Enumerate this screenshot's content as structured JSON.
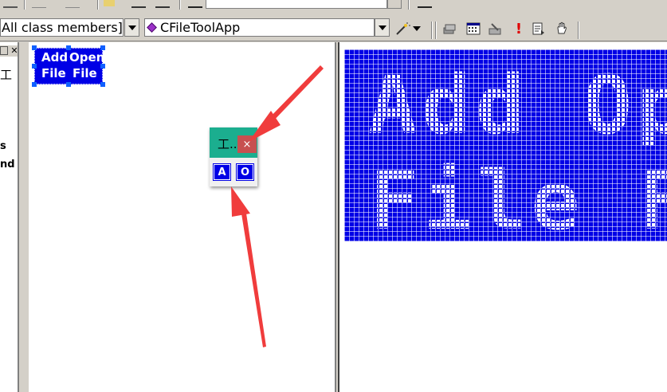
{
  "toolbar": {
    "class_filter": "All class members]",
    "class_name": "CFileToolApp",
    "search_value": ""
  },
  "left_pane": {
    "glyph": "工",
    "text_line_1": "s",
    "text_line_2": "nd"
  },
  "resource_bitmap": {
    "label_add": "Add",
    "label_open": "Open",
    "label_file_1": "File",
    "label_file_2": "File"
  },
  "floating_toolbar": {
    "title": "工..",
    "close_glyph": "×",
    "button_a": "A",
    "button_o": "O"
  },
  "zoom_view": {
    "line_1": "Add Ope",
    "line_2": "File Fil"
  },
  "colors": {
    "bitmap_blue": "#0000e6",
    "title_teal": "#1bae8f",
    "close_red": "#c75050",
    "arrow_red": "#f03c3c"
  }
}
